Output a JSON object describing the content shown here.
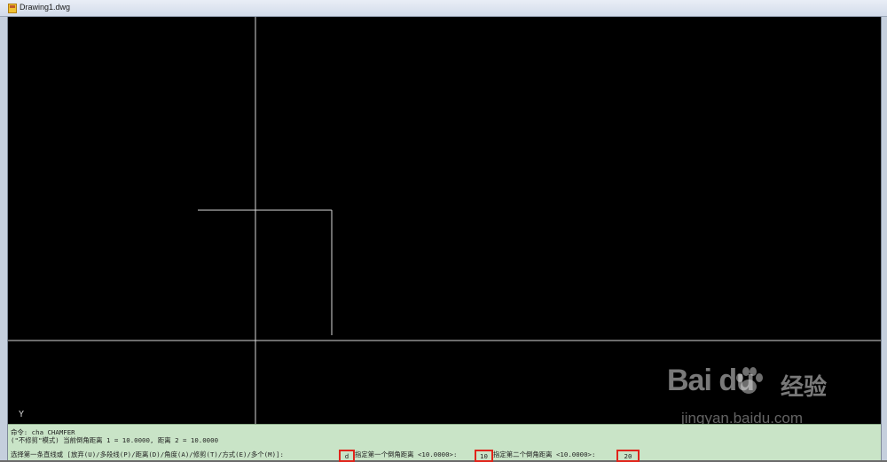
{
  "window": {
    "title": "Drawing1.dwg"
  },
  "canvas": {
    "ucs_label": "Y"
  },
  "command_window": {
    "history": [
      "命令: cha CHAMFER",
      "(\"不修剪\"模式) 当前倒角距离 1 = 10.0000, 距离 2 = 10.0000"
    ],
    "prompt_select": "选择第一条直线或 [放弃(U)/多段线(P)/距离(D)/角度(A)/修剪(T)/方式(E)/多个(M)]:",
    "input_option": "d",
    "prompt_first": "指定第一个倒角距离 <10.0000>:",
    "input_first": "10",
    "prompt_second": "指定第二个倒角距离 <10.0000>:",
    "input_second": "20"
  },
  "watermark": {
    "logo": "Bai du",
    "cn": "经验",
    "url": "jingyan.baidu.com"
  },
  "colors": {
    "canvas_bg": "#000000",
    "geometry_line": "#d9d9d9",
    "command_bg": "#c9e4c7",
    "highlight": "#e0241b"
  }
}
